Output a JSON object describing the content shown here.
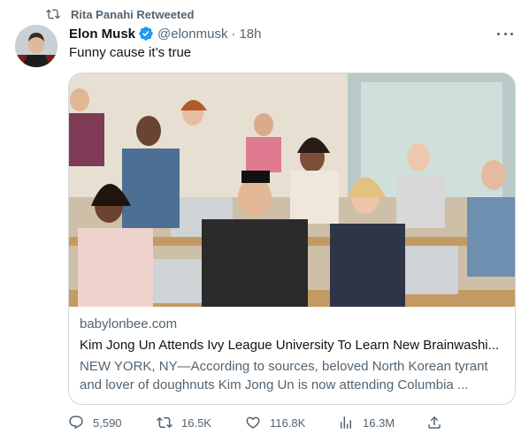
{
  "retweet": {
    "label": "Rita Panahi Retweeted",
    "icon": "retweet-icon"
  },
  "author": {
    "name": "Elon Musk",
    "handle": "@elonmusk",
    "separator": "·",
    "time": "18h",
    "verified_icon": "verified-badge-icon",
    "avatar_icon": "avatar-image"
  },
  "tweet": {
    "text": "Funny cause it’s true"
  },
  "card": {
    "image_icon": "classroom-photo",
    "domain": "babylonbee.com",
    "title": "Kim Jong Un Attends Ivy League University To Learn New Brainwashi...",
    "description": "NEW YORK, NY—According to sources, beloved North Korean tyrant and lover of doughnuts Kim Jong Un is now attending Columbia ..."
  },
  "actions": {
    "replies": "5,590",
    "retweets": "16.5K",
    "likes": "116.8K",
    "views": "16.3M",
    "icons": [
      "reply-icon",
      "retweet-icon",
      "like-icon",
      "views-icon",
      "share-icon"
    ]
  },
  "colors": {
    "text": "#0f1419",
    "secondary": "#536471",
    "border": "#cfd9de",
    "verified": "#1d9bf0"
  }
}
